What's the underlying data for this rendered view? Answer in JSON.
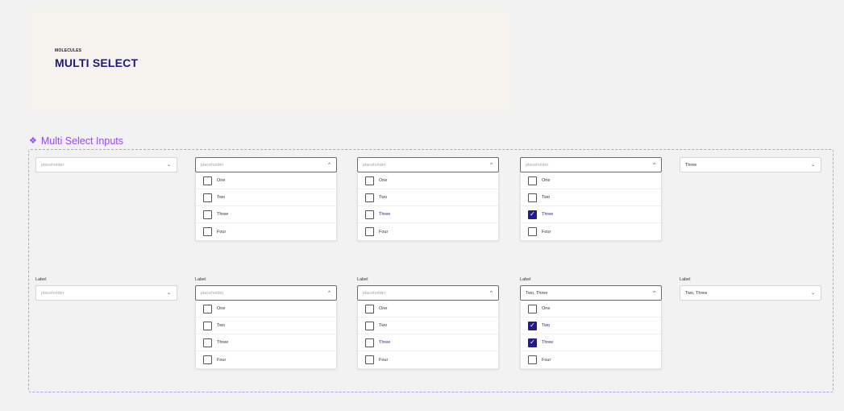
{
  "header": {
    "eyebrow": "MOLECULES",
    "title": "MULTI SELECT"
  },
  "section": {
    "title": "Multi Select Inputs",
    "icon": "component-icon"
  },
  "chevron_down": "⌄",
  "chevron_up": "^",
  "check": "✓",
  "colors": {
    "accent": "#231a8c",
    "frame": "#b39dfa",
    "section_title": "#9747ff"
  },
  "row1": [
    {
      "value": "placeholder",
      "is_placeholder": true,
      "open": false
    },
    {
      "value": "placeholder",
      "is_placeholder": true,
      "open": true,
      "options": [
        "One",
        "Two",
        "Three",
        "Four"
      ],
      "checked": [
        false,
        false,
        false,
        false
      ],
      "highlighted": null
    },
    {
      "value": "placeholder",
      "is_placeholder": true,
      "open": true,
      "options": [
        "One",
        "Two",
        "Three",
        "Four"
      ],
      "checked": [
        false,
        false,
        false,
        false
      ],
      "highlighted": 2
    },
    {
      "value": "placeholder",
      "is_placeholder": true,
      "open": true,
      "options": [
        "One",
        "Two",
        "Three",
        "Four"
      ],
      "checked": [
        false,
        false,
        true,
        false
      ],
      "highlighted": 2
    },
    {
      "value": "Three",
      "is_placeholder": false,
      "open": false
    }
  ],
  "row2": [
    {
      "label": "Label",
      "value": "placeholder",
      "is_placeholder": true,
      "open": false
    },
    {
      "label": "Label",
      "value": "placeholder",
      "is_placeholder": true,
      "open": true,
      "options": [
        "One",
        "Two",
        "Three",
        "Four"
      ],
      "checked": [
        false,
        false,
        false,
        false
      ],
      "highlighted": null
    },
    {
      "label": "Label",
      "value": "placeholder",
      "is_placeholder": true,
      "open": true,
      "options": [
        "One",
        "Two",
        "Three",
        "Four"
      ],
      "checked": [
        false,
        false,
        false,
        false
      ],
      "highlighted": 2
    },
    {
      "label": "Label",
      "value": "Two, Three",
      "is_placeholder": false,
      "open": true,
      "options": [
        "One",
        "Two",
        "Three",
        "Four"
      ],
      "checked": [
        false,
        true,
        true,
        false
      ],
      "highlighted": 2
    },
    {
      "label": "Label",
      "value": "Two, Three",
      "is_placeholder": false,
      "open": false
    }
  ]
}
